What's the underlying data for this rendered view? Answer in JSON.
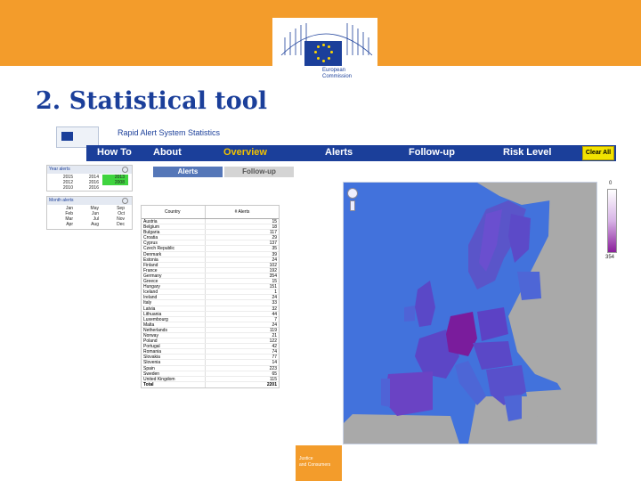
{
  "slide": {
    "title": "2. Statistical tool"
  },
  "branding": {
    "line1": "European",
    "line2": "Commission",
    "footer_line1": "Justice",
    "footer_line2": "and Consumers"
  },
  "app": {
    "title": "Rapid Alert System Statistics",
    "nav": {
      "how_to": "How To",
      "about": "About",
      "overview": "Overview",
      "alerts": "Alerts",
      "follow_up": "Follow-up",
      "risk_level": "Risk Level"
    },
    "clear_all": "Clear All",
    "tabs": {
      "alerts": "Alerts",
      "follow_up": "Follow-up"
    }
  },
  "year_panel": {
    "header": "Year alerts",
    "cells": [
      "2015",
      "2014",
      "2013",
      "2012",
      "2016",
      "2008",
      "2010",
      "2016",
      ""
    ]
  },
  "month_panel": {
    "header": "Month alerts",
    "cells": [
      "Jan",
      "May",
      "Sep",
      "Feb",
      "Jun",
      "Oct",
      "Mar",
      "Jul",
      "Nov",
      "Apr",
      "Aug",
      "Dec"
    ]
  },
  "table": {
    "col_country": "Country",
    "col_alerts": "# Alerts",
    "rows": [
      [
        "Austria",
        "15"
      ],
      [
        "Belgium",
        "18"
      ],
      [
        "Bulgaria",
        "117"
      ],
      [
        "Croatia",
        "29"
      ],
      [
        "Cyprus",
        "137"
      ],
      [
        "Czech Republic",
        "35"
      ],
      [
        "Denmark",
        "39"
      ],
      [
        "Estonia",
        "24"
      ],
      [
        "Finland",
        "102"
      ],
      [
        "France",
        "192"
      ],
      [
        "Germany",
        "354"
      ],
      [
        "Greece",
        "15"
      ],
      [
        "Hungary",
        "151"
      ],
      [
        "Iceland",
        "1"
      ],
      [
        "Ireland",
        "24"
      ],
      [
        "Italy",
        "33"
      ],
      [
        "Latvia",
        "32"
      ],
      [
        "Lithuania",
        "44"
      ],
      [
        "Luxembourg",
        "7"
      ],
      [
        "Malta",
        "24"
      ],
      [
        "Netherlands",
        "119"
      ],
      [
        "Norway",
        "21"
      ],
      [
        "Poland",
        "122"
      ],
      [
        "Portugal",
        "42"
      ],
      [
        "Romania",
        "74"
      ],
      [
        "Slovakia",
        "77"
      ],
      [
        "Slovenia",
        "14"
      ],
      [
        "Spain",
        "223"
      ],
      [
        "Sweden",
        "65"
      ],
      [
        "United Kingdom",
        "115"
      ]
    ],
    "total_label": "Total",
    "total_value": "2201"
  },
  "legend": {
    "min": "0",
    "max": "354"
  },
  "colors": {
    "accent": "#f39c2b",
    "brand_blue": "#1b3f9a",
    "map_sea": "#4272dc",
    "highlight_green": "#3fd43f"
  }
}
